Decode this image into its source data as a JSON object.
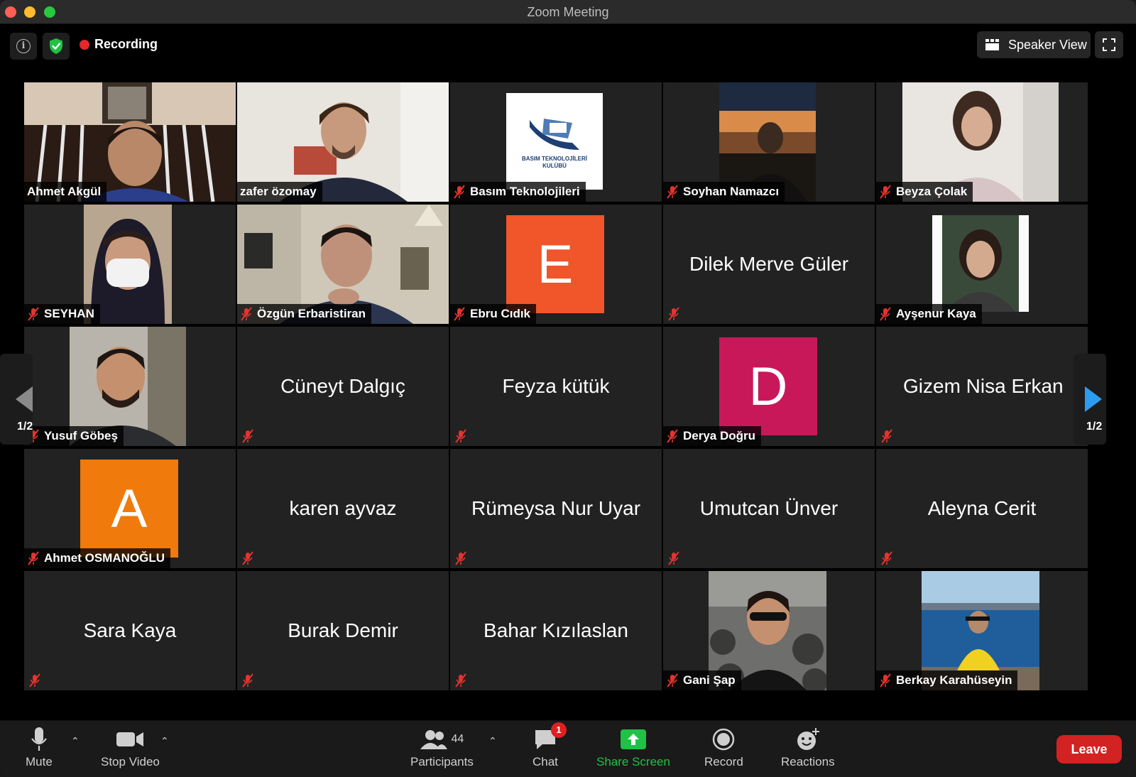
{
  "window": {
    "title": "Zoom Meeting"
  },
  "topbar": {
    "recording_label": "Recording",
    "view_button": "Speaker View"
  },
  "pagination": {
    "left": "1/2",
    "right": "1/2"
  },
  "participants": [
    {
      "name": "Ahmet Akgül",
      "muted": false,
      "video": true,
      "active": true,
      "display": "photo",
      "label_visible": true
    },
    {
      "name": "zafer özomay",
      "muted": false,
      "video": true,
      "display": "photo",
      "label_visible": true
    },
    {
      "name": "Basım Teknolojileri",
      "muted": true,
      "video": true,
      "display": "logo",
      "logo_text": "BASIM TEKNOLOJİLERİ KULÜBÜ",
      "label_visible": true
    },
    {
      "name": "Soyhan Namazcı",
      "muted": true,
      "video": true,
      "display": "photo",
      "label_visible": true
    },
    {
      "name": "Beyza Çolak",
      "muted": true,
      "video": true,
      "display": "photo",
      "label_visible": true
    },
    {
      "name": "SEYHAN",
      "muted": true,
      "video": true,
      "display": "photo",
      "label_visible": true
    },
    {
      "name": "Özgün Erbaristiran",
      "muted": true,
      "video": true,
      "display": "photo",
      "label_visible": true
    },
    {
      "name": "Ebru Cıdık",
      "muted": true,
      "video": false,
      "display": "avatar",
      "initial": "E",
      "avatar_color": "#f1552a",
      "label_visible": true
    },
    {
      "name": "Dilek Merve Güler",
      "muted": true,
      "video": false,
      "display": "name",
      "label_visible": false
    },
    {
      "name": "Ayşenur Kaya",
      "muted": true,
      "video": true,
      "display": "photo",
      "label_visible": true
    },
    {
      "name": "Yusuf Göbeş",
      "muted": true,
      "video": true,
      "display": "photo",
      "label_visible": true
    },
    {
      "name": "Cüneyt Dalgıç",
      "muted": true,
      "video": false,
      "display": "name",
      "label_visible": false
    },
    {
      "name": "Feyza kütük",
      "muted": true,
      "video": false,
      "display": "name",
      "label_visible": false
    },
    {
      "name": "Derya Doğru",
      "muted": true,
      "video": false,
      "display": "avatar",
      "initial": "D",
      "avatar_color": "#c8185a",
      "label_visible": true
    },
    {
      "name": "Gizem Nisa Erkan",
      "muted": true,
      "video": false,
      "display": "name",
      "label_visible": false
    },
    {
      "name": "Ahmet OSMANOĞLU",
      "muted": true,
      "video": false,
      "display": "avatar",
      "initial": "A",
      "avatar_color": "#f07a0c",
      "label_visible": true
    },
    {
      "name": "karen ayvaz",
      "muted": true,
      "video": false,
      "display": "name",
      "label_visible": false
    },
    {
      "name": "Rümeysa Nur Uyar",
      "muted": true,
      "video": false,
      "display": "name",
      "label_visible": false
    },
    {
      "name": "Umutcan Ünver",
      "muted": true,
      "video": false,
      "display": "name",
      "label_visible": false
    },
    {
      "name": "Aleyna Cerit",
      "muted": true,
      "video": false,
      "display": "name",
      "label_visible": false
    },
    {
      "name": "Sara Kaya",
      "muted": true,
      "video": false,
      "display": "name",
      "label_visible": false
    },
    {
      "name": "Burak Demir",
      "muted": true,
      "video": false,
      "display": "name",
      "label_visible": false
    },
    {
      "name": "Bahar Kızılaslan",
      "muted": true,
      "video": false,
      "display": "name",
      "label_visible": false
    },
    {
      "name": "Gani Şap",
      "muted": true,
      "video": true,
      "display": "photo",
      "label_visible": true
    },
    {
      "name": "Berkay Karahüseyin",
      "muted": true,
      "video": true,
      "display": "photo",
      "label_visible": true
    }
  ],
  "toolbar": {
    "mute": "Mute",
    "stop_video": "Stop Video",
    "participants": "Participants",
    "participant_count": "44",
    "chat": "Chat",
    "chat_badge": "1",
    "share_screen": "Share Screen",
    "record": "Record",
    "reactions": "Reactions",
    "leave": "Leave"
  },
  "colors": {
    "active_speaker_border": "#c7e84a",
    "share_screen_green": "#1fc244",
    "leave_red": "#d32222",
    "recording_red": "#e4282b",
    "page_arrow_blue": "#2d9bf0"
  }
}
